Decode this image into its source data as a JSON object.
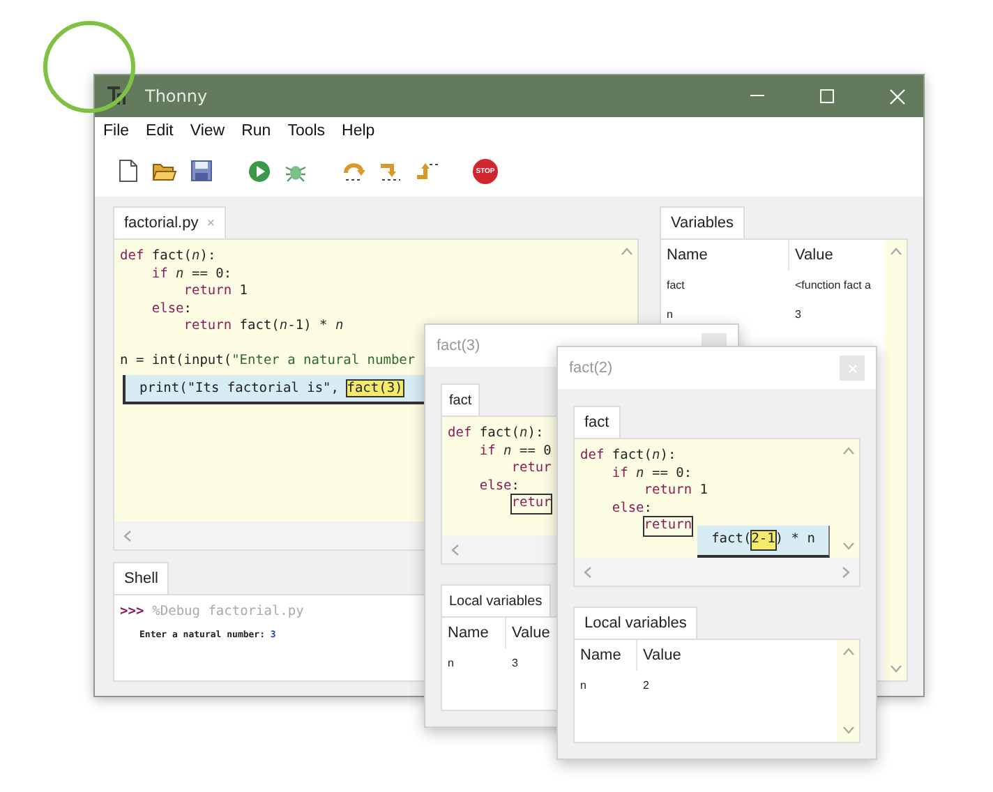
{
  "window": {
    "title": "Thonny"
  },
  "menu": [
    "File",
    "Edit",
    "View",
    "Run",
    "Tools",
    "Help"
  ],
  "toolbar": [
    {
      "kind": "new"
    },
    {
      "kind": "open"
    },
    {
      "kind": "save"
    },
    {
      "kind": "run"
    },
    {
      "kind": "debug"
    },
    {
      "kind": "step_over"
    },
    {
      "kind": "step_into"
    },
    {
      "kind": "step_out"
    },
    {
      "kind": "stop",
      "label": "STOP"
    }
  ],
  "editor": {
    "tab": "factorial.py",
    "close": "×",
    "lines": [
      {
        "kind": "code",
        "tokens": [
          {
            "kind": "kw",
            "text": "def"
          },
          {
            "kind": "plain",
            "text": " fact("
          },
          {
            "kind": "var",
            "text": "n"
          },
          {
            "kind": "plain",
            "text": "):"
          }
        ]
      },
      {
        "kind": "code",
        "tokens": [
          {
            "kind": "kw",
            "text": "    if "
          },
          {
            "kind": "var",
            "text": "n"
          },
          {
            "kind": "plain",
            "text": " == 0:"
          }
        ]
      },
      {
        "kind": "code",
        "tokens": [
          {
            "kind": "kw",
            "text": "        return"
          },
          {
            "kind": "plain",
            "text": " 1"
          }
        ]
      },
      {
        "kind": "code",
        "tokens": [
          {
            "kind": "kw",
            "text": "    else"
          },
          {
            "kind": "plain",
            "text": ":"
          }
        ]
      },
      {
        "kind": "code",
        "tokens": [
          {
            "kind": "kw",
            "text": "        return"
          },
          {
            "kind": "plain",
            "text": " fact("
          },
          {
            "kind": "var",
            "text": "n"
          },
          {
            "kind": "plain",
            "text": "-1) * "
          },
          {
            "kind": "var",
            "text": "n"
          }
        ]
      },
      {
        "kind": "blank"
      },
      {
        "kind": "code",
        "tokens": [
          {
            "kind": "plain",
            "text": "n = int(input("
          },
          {
            "kind": "str",
            "text": "\"Enter a natural number"
          }
        ]
      }
    ],
    "popup": {
      "prefix": "print(\"Its factorial is\", ",
      "highlight": "fact(3)"
    }
  },
  "shell": {
    "tab": "Shell",
    "lines": [
      {
        "kind": "command",
        "prompt": ">>>",
        "text": "%Debug factorial.py"
      },
      {
        "kind": "output",
        "text": "Enter a natural number: ",
        "input": "3"
      }
    ]
  },
  "variables": {
    "tab": "Variables",
    "columns": [
      "Name",
      "Value"
    ],
    "rows": [
      [
        "fact",
        "<function fact a"
      ],
      [
        "n",
        "3"
      ]
    ]
  },
  "frames": [
    {
      "title": "fact(3)",
      "tab": "fact",
      "lines": [
        {
          "kind": "code",
          "tokens": [
            {
              "kind": "kw",
              "text": "def"
            },
            {
              "kind": "plain",
              "text": " fact("
            },
            {
              "kind": "var",
              "text": "n"
            },
            {
              "kind": "plain",
              "text": "):"
            }
          ]
        },
        {
          "kind": "code",
          "tokens": [
            {
              "kind": "kw",
              "text": "    if "
            },
            {
              "kind": "var",
              "text": "n"
            },
            {
              "kind": "plain",
              "text": " == 0"
            }
          ]
        },
        {
          "kind": "code",
          "tokens": [
            {
              "kind": "kw",
              "text": "        retur"
            }
          ]
        },
        {
          "kind": "code",
          "tokens": [
            {
              "kind": "kw",
              "text": "    else"
            },
            {
              "kind": "plain",
              "text": ":"
            }
          ]
        },
        {
          "kind": "focus",
          "text": "retur"
        }
      ],
      "locals_tab": "Local variables",
      "columns": [
        "Name",
        "Value"
      ],
      "rows": [
        [
          "n",
          "3"
        ]
      ]
    },
    {
      "title": "fact(2)",
      "tab": "fact",
      "lines": [
        {
          "kind": "code",
          "tokens": [
            {
              "kind": "kw",
              "text": "def"
            },
            {
              "kind": "plain",
              "text": " fact("
            },
            {
              "kind": "var",
              "text": "n"
            },
            {
              "kind": "plain",
              "text": "):"
            }
          ]
        },
        {
          "kind": "code",
          "tokens": [
            {
              "kind": "kw",
              "text": "    if "
            },
            {
              "kind": "var",
              "text": "n"
            },
            {
              "kind": "plain",
              "text": " == 0:"
            }
          ]
        },
        {
          "kind": "code",
          "tokens": [
            {
              "kind": "kw",
              "text": "        return"
            },
            {
              "kind": "plain",
              "text": " 1"
            }
          ]
        },
        {
          "kind": "code",
          "tokens": [
            {
              "kind": "kw",
              "text": "    else"
            },
            {
              "kind": "plain",
              "text": ":"
            }
          ]
        },
        {
          "kind": "focus",
          "text": "return"
        }
      ],
      "popup": {
        "prefix": "fact(",
        "highlight": "2-1",
        "suffix": ") * n"
      },
      "locals_tab": "Local variables",
      "columns": [
        "Name",
        "Value"
      ],
      "rows": [
        [
          "n",
          "2"
        ]
      ]
    }
  ]
}
